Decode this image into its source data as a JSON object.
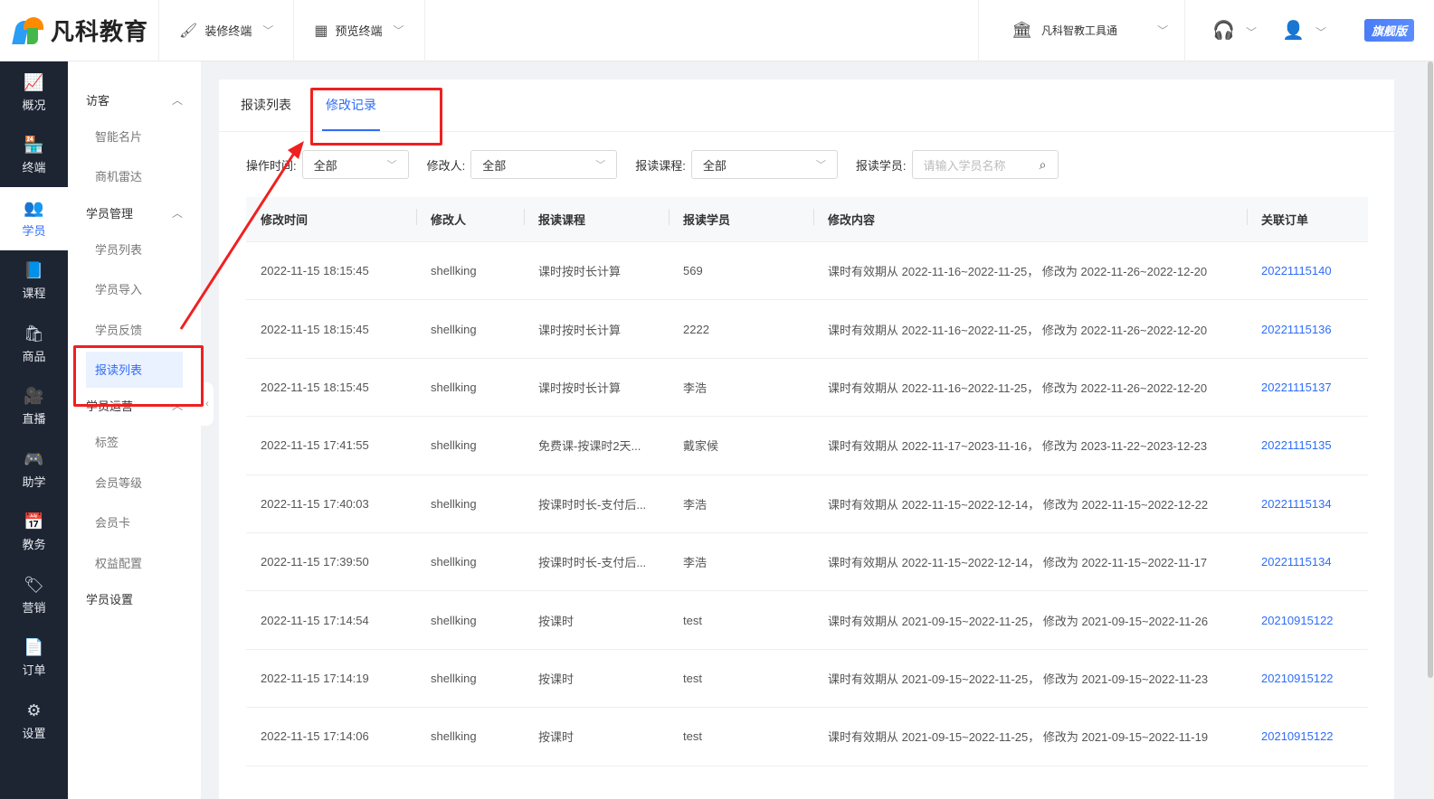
{
  "header": {
    "brand": "凡科教育",
    "menus": [
      {
        "label": "装修终端",
        "icon": "paint-roller-icon"
      },
      {
        "label": "预览终端",
        "icon": "qr-grid-icon"
      }
    ],
    "tool_label": "凡科智教工具通",
    "edition_badge": "旗舰版"
  },
  "nav": {
    "items": [
      {
        "label": "概况",
        "icon": "chart-icon",
        "glyph": "📈"
      },
      {
        "label": "终端",
        "icon": "store-icon",
        "glyph": "🏪"
      },
      {
        "label": "学员",
        "icon": "users-icon",
        "glyph": "👥"
      },
      {
        "label": "课程",
        "icon": "book-icon",
        "glyph": "📘"
      },
      {
        "label": "商品",
        "icon": "bag-icon",
        "glyph": "🛍"
      },
      {
        "label": "直播",
        "icon": "camera-icon",
        "glyph": "🎥"
      },
      {
        "label": "助学",
        "icon": "gamepad-icon",
        "glyph": "🎮"
      },
      {
        "label": "教务",
        "icon": "calendar-icon",
        "glyph": "📅"
      },
      {
        "label": "营销",
        "icon": "tag-icon",
        "glyph": "🏷"
      },
      {
        "label": "订单",
        "icon": "document-icon",
        "glyph": "📄"
      },
      {
        "label": "设置",
        "icon": "gear-icon",
        "glyph": "⚙"
      }
    ],
    "active_index": 2
  },
  "subnav": {
    "groups": [
      {
        "title": "访客",
        "items": [
          "智能名片",
          "商机雷达"
        ]
      },
      {
        "title": "学员管理",
        "items": [
          "学员列表",
          "学员导入",
          "学员反馈",
          "报读列表"
        ]
      },
      {
        "title": "学员运营",
        "items": [
          "标签",
          "会员等级",
          "会员卡",
          "权益配置"
        ]
      }
    ],
    "last_item": "学员设置",
    "active_item": "报读列表"
  },
  "tabs": [
    "报读列表",
    "修改记录"
  ],
  "active_tab": "修改记录",
  "filters": {
    "time_label": "操作时间:",
    "time_value": "全部",
    "editor_label": "修改人:",
    "editor_value": "全部",
    "course_label": "报读课程:",
    "course_value": "全部",
    "student_label": "报读学员:",
    "student_placeholder": "请输入学员名称"
  },
  "table": {
    "columns": [
      "修改时间",
      "修改人",
      "报读课程",
      "报读学员",
      "修改内容",
      "关联订单"
    ],
    "rows": [
      [
        "2022-11-15 18:15:45",
        "shellking",
        "课时按时长计算",
        "569",
        "课时有效期从 2022-11-16~2022-11-25， 修改为 2022-11-26~2022-12-20",
        "20221115140"
      ],
      [
        "2022-11-15 18:15:45",
        "shellking",
        "课时按时长计算",
        "2222",
        "课时有效期从 2022-11-16~2022-11-25， 修改为 2022-11-26~2022-12-20",
        "20221115136"
      ],
      [
        "2022-11-15 18:15:45",
        "shellking",
        "课时按时长计算",
        "李浩",
        "课时有效期从 2022-11-16~2022-11-25， 修改为 2022-11-26~2022-12-20",
        "20221115137"
      ],
      [
        "2022-11-15 17:41:55",
        "shellking",
        "免费课-按课时2天...",
        "戴家候",
        "课时有效期从 2022-11-17~2023-11-16， 修改为 2023-11-22~2023-12-23",
        "20221115135"
      ],
      [
        "2022-11-15 17:40:03",
        "shellking",
        "按课时时长-支付后...",
        "李浩",
        "课时有效期从 2022-11-15~2022-12-14， 修改为 2022-11-15~2022-12-22",
        "20221115134"
      ],
      [
        "2022-11-15 17:39:50",
        "shellking",
        "按课时时长-支付后...",
        "李浩",
        "课时有效期从 2022-11-15~2022-12-14， 修改为 2022-11-15~2022-11-17",
        "20221115134"
      ],
      [
        "2022-11-15 17:14:54",
        "shellking",
        "按课时",
        "test",
        "课时有效期从 2021-09-15~2022-11-25， 修改为 2021-09-15~2022-11-26",
        "20210915122"
      ],
      [
        "2022-11-15 17:14:19",
        "shellking",
        "按课时",
        "test",
        "课时有效期从 2021-09-15~2022-11-25， 修改为 2021-09-15~2022-11-23",
        "20210915122"
      ],
      [
        "2022-11-15 17:14:06",
        "shellking",
        "按课时",
        "test",
        "课时有效期从 2021-09-15~2022-11-25， 修改为 2021-09-15~2022-11-19",
        "20210915122"
      ]
    ]
  },
  "colors": {
    "accent": "#2f6df6",
    "nav_bg": "#1d2533",
    "annotation_red": "#f02020"
  }
}
